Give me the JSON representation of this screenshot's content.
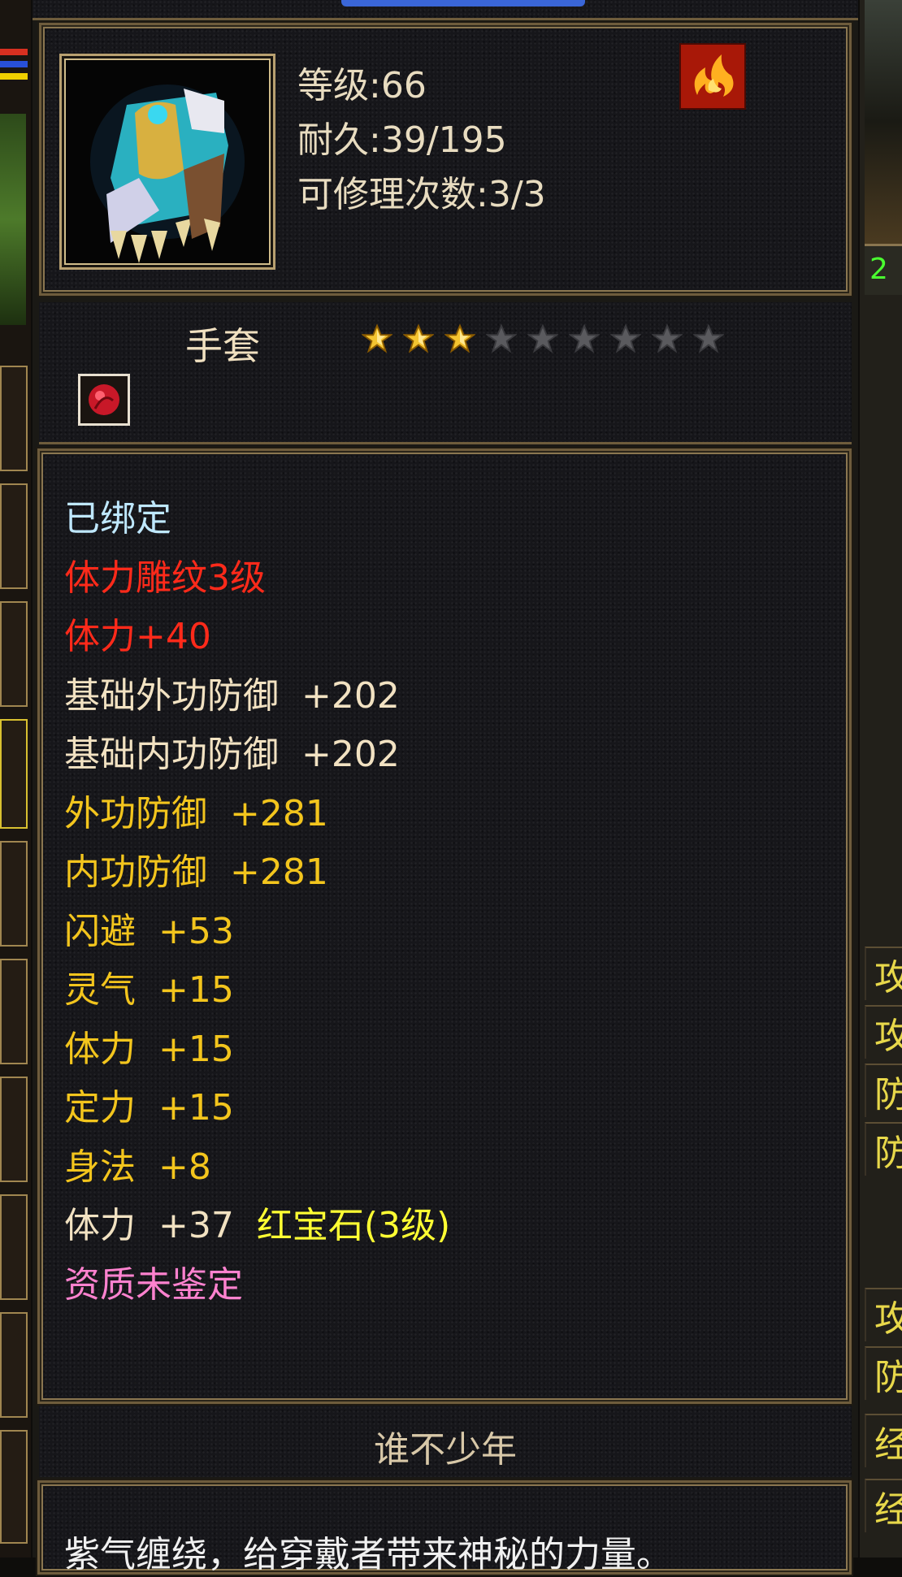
{
  "item": {
    "stats_header": {
      "level_label": "等级",
      "level_value": "66",
      "durability_label": "耐久",
      "durability_value": "39/195",
      "repair_label": "可修理次数",
      "repair_value": "3/3"
    },
    "type_label": "手套",
    "stars": {
      "filled": 3,
      "total": 9
    },
    "icons": {
      "item_image": "gauntlet-icon",
      "element_badge": "fire-flame-icon",
      "gem_slot": "red-gem-socket-icon"
    },
    "attributes": [
      {
        "text": "已绑定",
        "color": "#bfe8ff"
      },
      {
        "text": "体力雕纹3级",
        "color": "#ff2a1a"
      },
      {
        "text": "体力+40",
        "color": "#ff2a1a"
      },
      {
        "text": "基础外功防御  +202",
        "color": "#f2e2c2"
      },
      {
        "text": "基础内功防御  +202",
        "color": "#f2e2c2"
      },
      {
        "text": "外功防御  +281",
        "color": "#f3c51d"
      },
      {
        "text": "内功防御  +281",
        "color": "#f3c51d"
      },
      {
        "text": "闪避  +53",
        "color": "#f3c51d"
      },
      {
        "text": "灵气  +15",
        "color": "#f3c51d"
      },
      {
        "text": "体力  +15",
        "color": "#f3c51d"
      },
      {
        "text": "定力  +15",
        "color": "#f3c51d"
      },
      {
        "text": "身法  +8",
        "color": "#f3c51d"
      }
    ],
    "gem_line": {
      "stat": "体力  +37",
      "gem": "红宝石(3级)",
      "stat_color": "#f2e2c2",
      "gem_color": "#ffff33"
    },
    "quality": {
      "text": "资质未鉴定",
      "color": "#ff82cf"
    },
    "set_name": "谁不少年",
    "description": "紫气缠绕，给穿戴者带来神秘的力量。"
  },
  "side_panel": {
    "rows": [
      "攻",
      "攻",
      "防",
      "防",
      "攻",
      "防",
      "经",
      "经"
    ],
    "top_text": "2"
  }
}
